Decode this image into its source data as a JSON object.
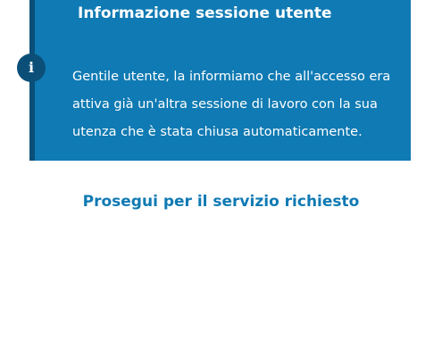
{
  "alert": {
    "title": "Informazione sessione utente",
    "icon": "i",
    "icon_name": "info-icon",
    "message": "Gentile utente, la informiamo che all'accesso era attiva già un'altra sessione di lavoro con la sua utenza che è stata chiusa automaticamente.",
    "background_color": "#0f7ab3",
    "accent_color": "#0b4f78"
  },
  "action": {
    "continue_label": "Prosegui per il servizio richiesto",
    "link_color": "#0f7ab3"
  }
}
